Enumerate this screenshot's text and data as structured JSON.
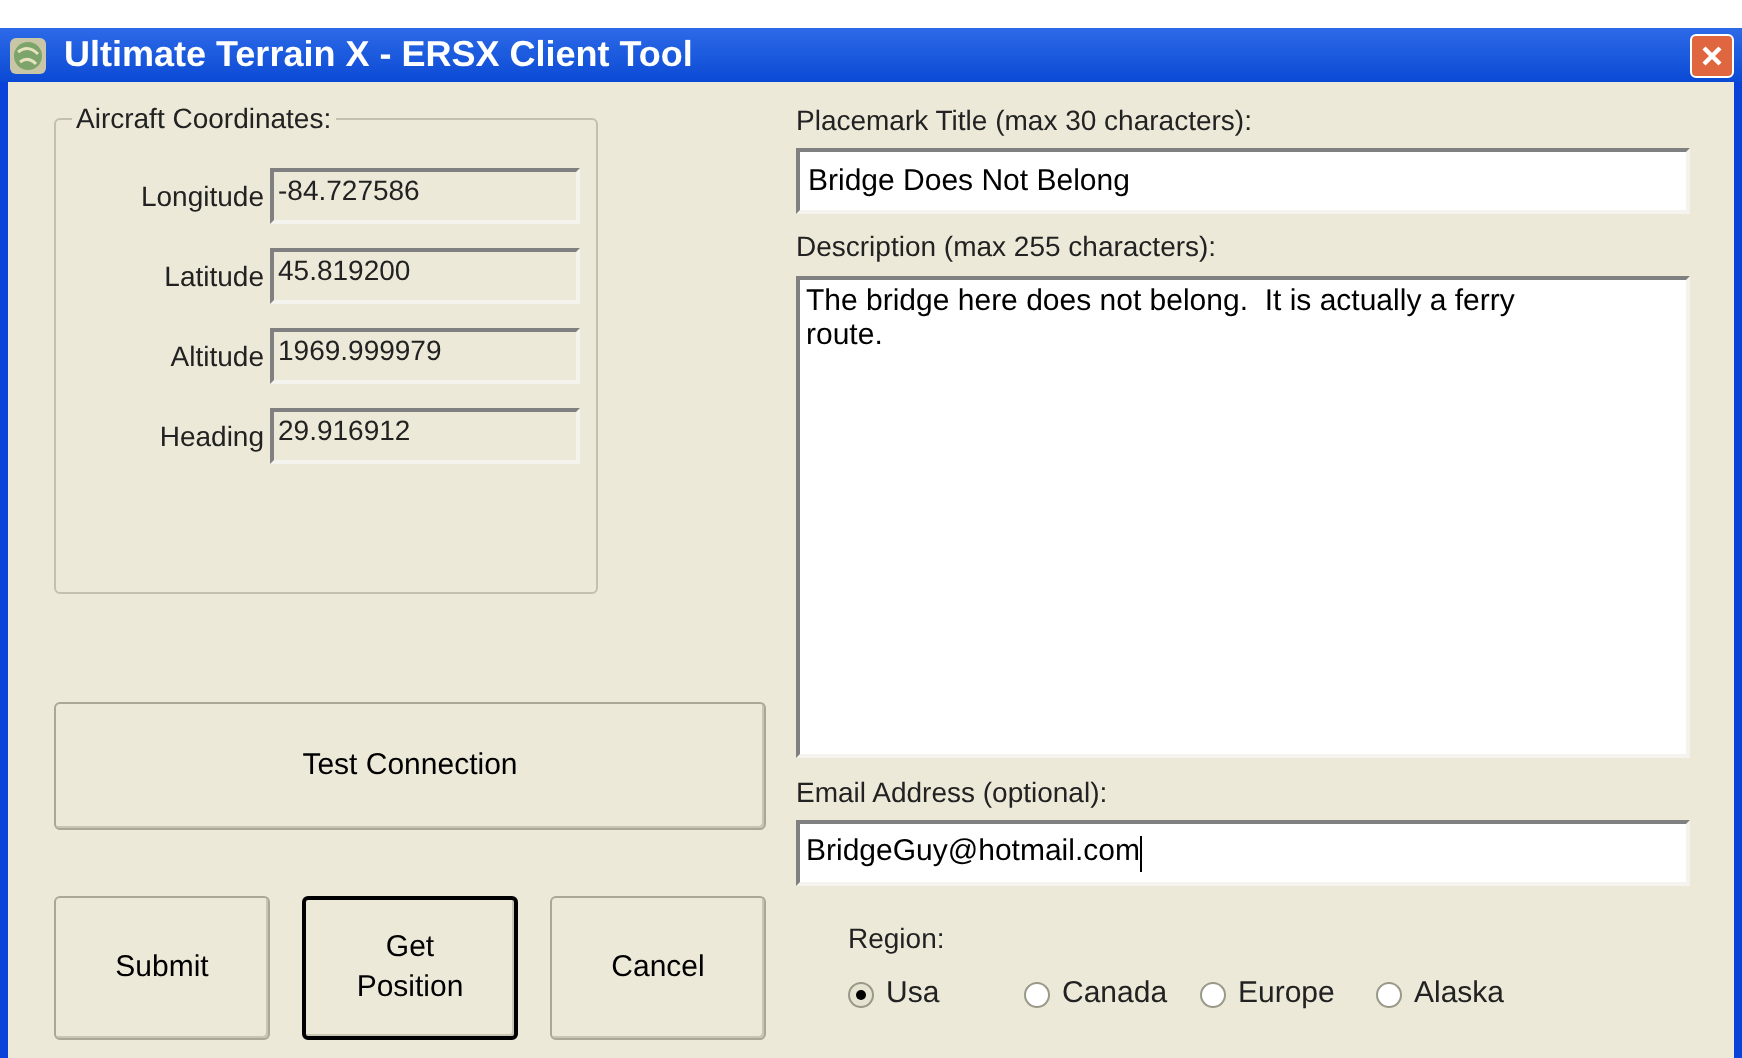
{
  "window": {
    "title": "Ultimate Terrain X - ERSX Client Tool"
  },
  "coordinates": {
    "title": "Aircraft Coordinates:",
    "fields": [
      {
        "label": "Longitude",
        "value": "-84.727586"
      },
      {
        "label": "Latitude",
        "value": "45.819200"
      },
      {
        "label": "Altitude",
        "value": "1969.999979"
      },
      {
        "label": "Heading",
        "value": "29.916912"
      }
    ]
  },
  "test_button": "Test Connection",
  "buttons": [
    {
      "label": "Submit",
      "default": false
    },
    {
      "label": "Get Position",
      "default": true
    },
    {
      "label": "Cancel",
      "default": false
    }
  ],
  "placemark": {
    "label": "Placemark Title (max 30 characters):",
    "value": "Bridge Does Not Belong"
  },
  "description": {
    "label": "Description (max 255 characters):",
    "value": "The bridge here does not belong.  It is actually a ferry route."
  },
  "email": {
    "label": "Email Address (optional):",
    "value": "BridgeGuy@hotmail.com",
    "focused": true
  },
  "region": {
    "label": "Region:",
    "options": [
      {
        "label": "Usa",
        "selected": true
      },
      {
        "label": "Canada",
        "selected": false
      },
      {
        "label": "Europe",
        "selected": false
      },
      {
        "label": "Alaska",
        "selected": false
      }
    ]
  }
}
